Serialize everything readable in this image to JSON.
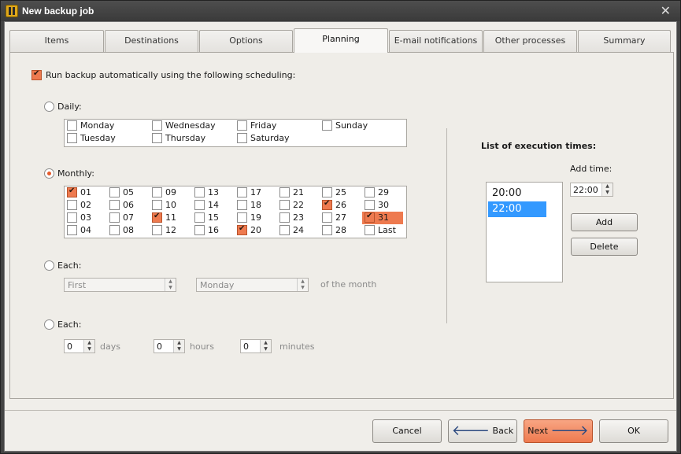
{
  "window": {
    "title": "New backup job",
    "close_glyph": "✕"
  },
  "tabs": [
    {
      "label": "Items",
      "active": false
    },
    {
      "label": "Destinations",
      "active": false
    },
    {
      "label": "Options",
      "active": false
    },
    {
      "label": "Planning",
      "active": true
    },
    {
      "label": "E-mail notifications",
      "active": false
    },
    {
      "label": "Other processes",
      "active": false
    },
    {
      "label": "Summary",
      "active": false
    }
  ],
  "planning": {
    "auto_run": {
      "label": "Run backup automatically using the following scheduling:",
      "checked": true
    },
    "daily": {
      "label": "Daily:",
      "selected": false,
      "days": [
        {
          "label": "Monday",
          "checked": false
        },
        {
          "label": "Wednesday",
          "checked": false
        },
        {
          "label": "Friday",
          "checked": false
        },
        {
          "label": "Sunday",
          "checked": false
        },
        {
          "label": "Tuesday",
          "checked": false
        },
        {
          "label": "Thursday",
          "checked": false
        },
        {
          "label": "Saturday",
          "checked": false
        }
      ]
    },
    "monthly": {
      "label": "Monthly:",
      "selected": true,
      "days": [
        {
          "label": "01",
          "checked": true
        },
        {
          "label": "05",
          "checked": false
        },
        {
          "label": "09",
          "checked": false
        },
        {
          "label": "13",
          "checked": false
        },
        {
          "label": "17",
          "checked": false
        },
        {
          "label": "21",
          "checked": false
        },
        {
          "label": "25",
          "checked": false
        },
        {
          "label": "29",
          "checked": false
        },
        {
          "label": "02",
          "checked": false
        },
        {
          "label": "06",
          "checked": false
        },
        {
          "label": "10",
          "checked": false
        },
        {
          "label": "14",
          "checked": false
        },
        {
          "label": "18",
          "checked": false
        },
        {
          "label": "22",
          "checked": false
        },
        {
          "label": "26",
          "checked": true
        },
        {
          "label": "30",
          "checked": false
        },
        {
          "label": "03",
          "checked": false
        },
        {
          "label": "07",
          "checked": false
        },
        {
          "label": "11",
          "checked": true
        },
        {
          "label": "15",
          "checked": false
        },
        {
          "label": "19",
          "checked": false
        },
        {
          "label": "23",
          "checked": false
        },
        {
          "label": "27",
          "checked": false
        },
        {
          "label": "31",
          "checked": true,
          "highlighted": true
        },
        {
          "label": "04",
          "checked": false
        },
        {
          "label": "08",
          "checked": false
        },
        {
          "label": "12",
          "checked": false
        },
        {
          "label": "16",
          "checked": false
        },
        {
          "label": "20",
          "checked": true
        },
        {
          "label": "24",
          "checked": false
        },
        {
          "label": "28",
          "checked": false
        },
        {
          "label": "Last",
          "checked": false
        }
      ]
    },
    "each_relative": {
      "label": "Each:",
      "selected": false,
      "ordinal": "First",
      "weekday": "Monday",
      "suffix": "of the month"
    },
    "each_interval": {
      "label": "Each:",
      "selected": false,
      "days": {
        "value": "0",
        "unit": "days"
      },
      "hours": {
        "value": "0",
        "unit": "hours"
      },
      "minutes": {
        "value": "0",
        "unit": "minutes"
      }
    },
    "execution_times": {
      "title": "List of execution times:",
      "items": [
        {
          "label": "20:00",
          "selected": false
        },
        {
          "label": "22:00",
          "selected": true
        }
      ],
      "add_time_label": "Add time:",
      "add_time_value": "22:00",
      "add_button": "Add",
      "delete_button": "Delete"
    }
  },
  "footer": {
    "cancel": "Cancel",
    "back": "Back",
    "next": "Next",
    "ok": "OK"
  },
  "colors": {
    "accent": "#ee7a4f",
    "selection": "#3399ff"
  }
}
